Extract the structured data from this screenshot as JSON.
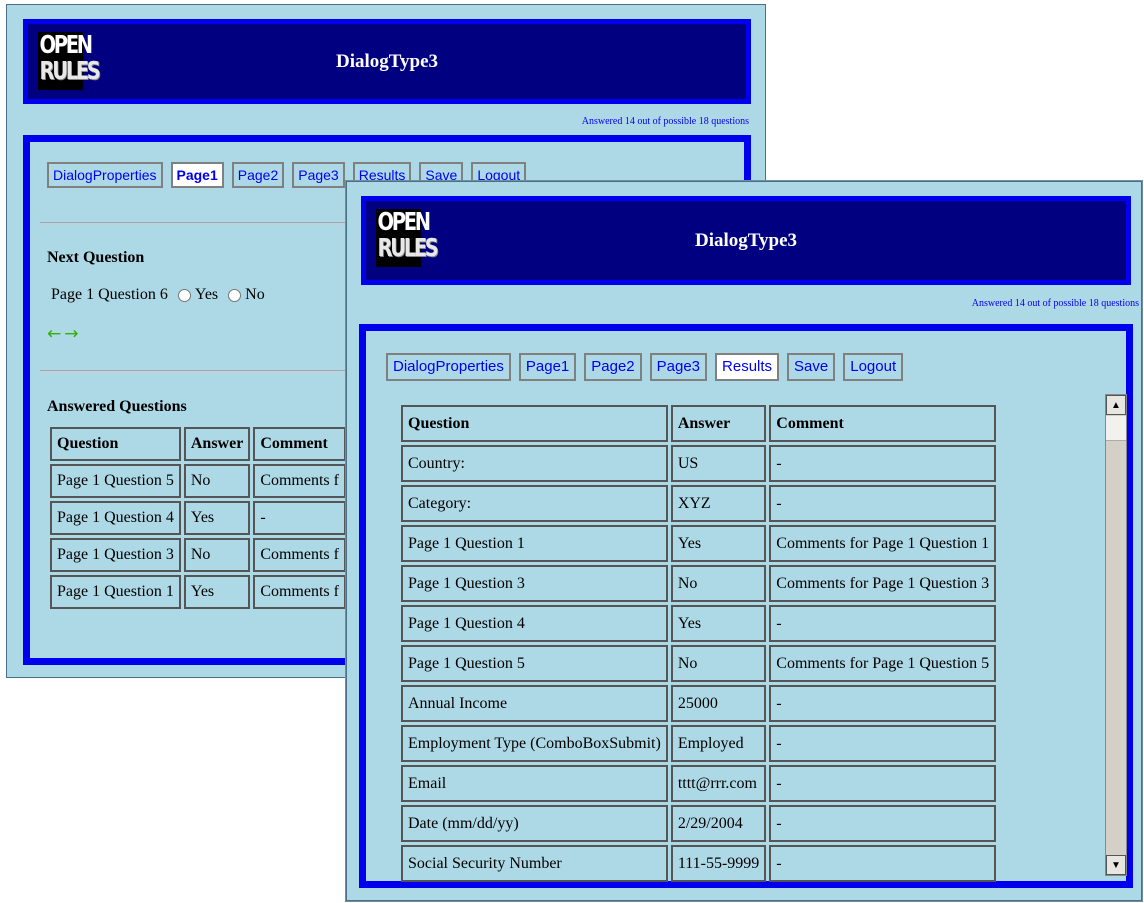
{
  "back_window": {
    "title": "DialogType3",
    "logo": [
      "OPEN",
      "RULES"
    ],
    "answered": "Answered 14 out of possible 18 questions",
    "tabs": [
      "DialogProperties",
      "Page1",
      "Page2",
      "Page3",
      "Results",
      "Save",
      "Logout"
    ],
    "active_tab": "Page1",
    "next_question": {
      "heading": "Next Question",
      "question": "Page 1 Question 6",
      "options": [
        "Yes",
        "No"
      ],
      "prev_icon": "←",
      "next_icon": "→"
    },
    "answered_questions": {
      "heading": "Answered Questions",
      "columns": [
        "Question",
        "Answer",
        "Comment"
      ],
      "rows": [
        [
          "Page 1 Question 5",
          "No",
          "Comments f"
        ],
        [
          "Page 1 Question 4",
          "Yes",
          "-"
        ],
        [
          "Page 1 Question 3",
          "No",
          "Comments f"
        ],
        [
          "Page 1 Question 1",
          "Yes",
          "Comments f"
        ]
      ]
    }
  },
  "front_window": {
    "title": "DialogType3",
    "logo": [
      "OPEN",
      "RULES"
    ],
    "answered": "Answered 14 out of possible 18 questions",
    "tabs": [
      "DialogProperties",
      "Page1",
      "Page2",
      "Page3",
      "Results",
      "Save",
      "Logout"
    ],
    "active_tab": "Results",
    "results": {
      "columns": [
        "Question",
        "Answer",
        "Comment"
      ],
      "rows": [
        [
          "Country:",
          "US",
          "-"
        ],
        [
          "Category:",
          "XYZ",
          "-"
        ],
        [
          "Page 1 Question 1",
          "Yes",
          "Comments for Page 1 Question 1"
        ],
        [
          "Page 1 Question 3",
          "No",
          "Comments for Page 1 Question 3"
        ],
        [
          "Page 1 Question 4",
          "Yes",
          "-"
        ],
        [
          "Page 1 Question 5",
          "No",
          "Comments for Page 1 Question 5"
        ],
        [
          "Annual Income",
          "25000",
          "-"
        ],
        [
          "Employment Type (ComboBoxSubmit)",
          "Employed",
          "-"
        ],
        [
          "Email",
          "tttt@rrr.com",
          "-"
        ],
        [
          "Date (mm/dd/yy)",
          "2/29/2004",
          "-"
        ],
        [
          "Social Security Number",
          "111-55-9999",
          "-"
        ]
      ]
    },
    "scroll_up": "▲",
    "scroll_down": "▼"
  },
  "colors": {
    "background": "#add8e6",
    "header": "#000080",
    "border": "#0000ee",
    "link": "#0000ee",
    "arrow": "#33b000"
  }
}
